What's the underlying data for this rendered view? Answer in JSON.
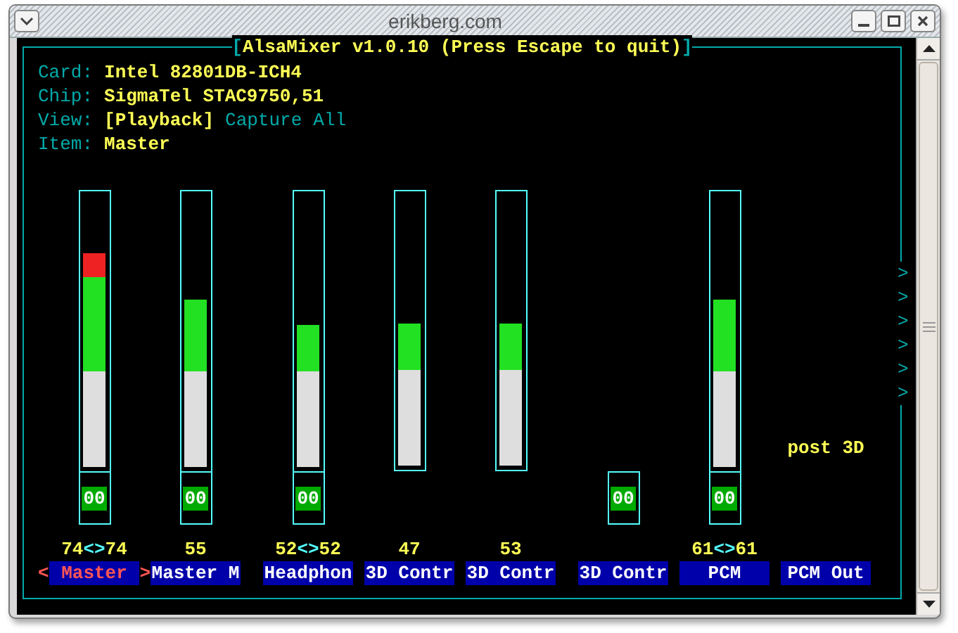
{
  "window": {
    "title": "erikberg.com"
  },
  "mixer": {
    "title": {
      "open": "[",
      "text": "AlsaMixer v1.0.10 (Press Escape to quit)",
      "close": "]"
    },
    "info": [
      {
        "label": "Card:",
        "value": "Intel 82801DB-ICH4"
      },
      {
        "label": "Chip:",
        "value": "SigmaTel STAC9750,51"
      }
    ],
    "view": {
      "label": "View:",
      "options": [
        {
          "label": "[Playback]",
          "selected": true
        },
        {
          "label": "Capture",
          "selected": false
        },
        {
          "label": "All",
          "selected": false
        }
      ]
    },
    "item": {
      "label": "Item:",
      "value": "Master"
    },
    "selection_marks": [
      "<",
      ">"
    ],
    "channels": [
      {
        "kind": "slider",
        "name": "Master",
        "selected": true,
        "level": 0.78,
        "mute": "00",
        "volume": [
          "74",
          "<>",
          "74"
        ]
      },
      {
        "kind": "slider",
        "name": "Master M",
        "selected": false,
        "level": 0.61,
        "mute": "00",
        "volume": [
          "55"
        ]
      },
      {
        "kind": "slider",
        "name": "Headphon",
        "selected": false,
        "level": 0.52,
        "mute": "00",
        "volume": [
          "52",
          "<>",
          "52"
        ]
      },
      {
        "kind": "slider_nomute",
        "name": "3D Contr",
        "selected": false,
        "level": 0.52,
        "volume": [
          "47"
        ]
      },
      {
        "kind": "slider_nomute",
        "name": "3D Contr",
        "selected": false,
        "level": 0.52,
        "volume": [
          "53"
        ]
      },
      {
        "kind": "switch",
        "name": "3D Contr",
        "selected": false,
        "mute": "00"
      },
      {
        "kind": "slider",
        "name": "PCM",
        "selected": false,
        "level": 0.61,
        "mute": "00",
        "volume": [
          "61",
          "<>",
          "61"
        ]
      },
      {
        "kind": "enum",
        "name": "PCM Out",
        "selected": false,
        "value": "post 3D"
      }
    ],
    "scroll_marks": [
      ">",
      ">",
      ">",
      ">",
      ">",
      ">"
    ]
  }
}
